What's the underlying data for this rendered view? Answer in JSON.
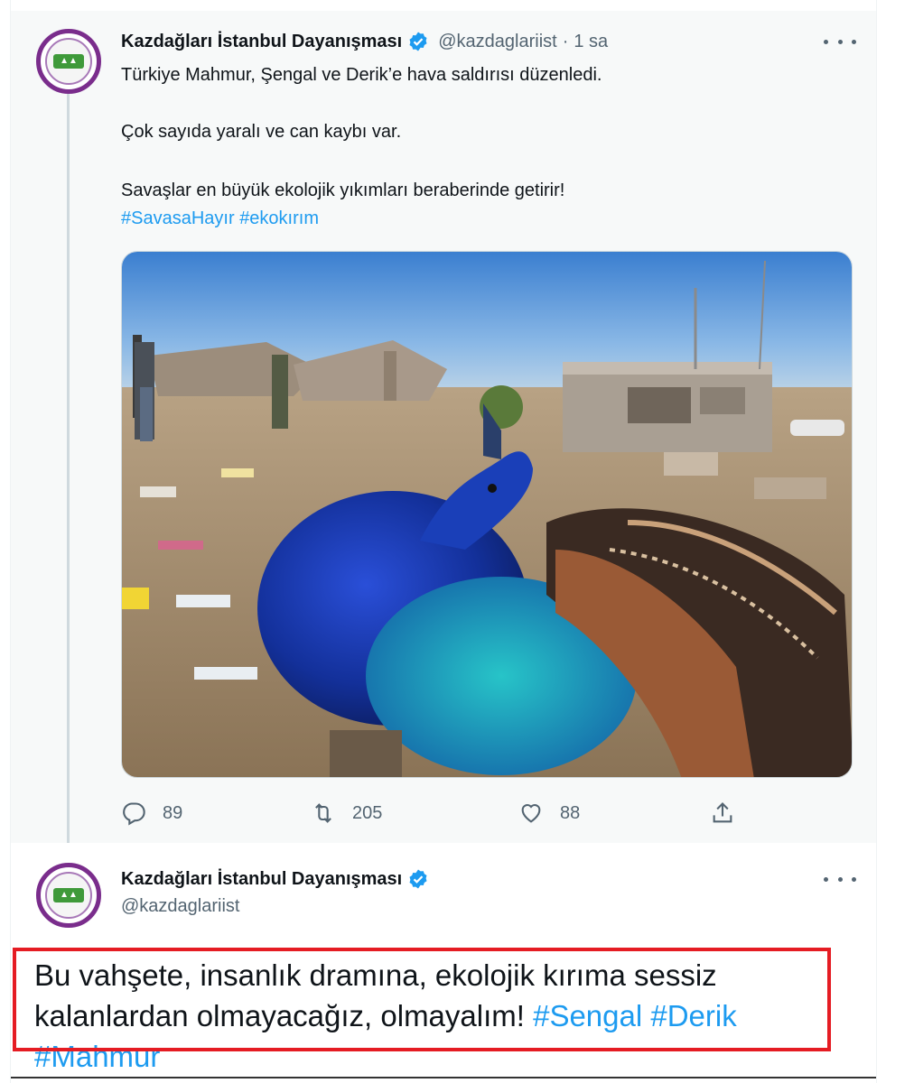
{
  "tweet": {
    "display_name": "Kazdağları İstanbul Dayanışması",
    "handle": "@kazdaglariist",
    "separator": "·",
    "time": "1 sa",
    "lines": [
      "Türkiye Mahmur, Şengal ve Derik’e hava saldırısı düzenledi.",
      "Çok sayıda yaralı ve can kaybı var.",
      "Savaşlar en büyük ekolojik yıkımları beraberinde getirir!"
    ],
    "hashtags": [
      "#SavasaHayır",
      "#ekokırım"
    ],
    "stats": {
      "replies": "89",
      "retweets": "205",
      "likes": "88"
    }
  },
  "reply": {
    "display_name": "Kazdağları İstanbul Dayanışması",
    "handle": "@kazdaglariist",
    "text_line1": "Bu vahşete, insanlık dramına, ekolojik kırıma sessiz",
    "text_line2": "kalanlardan olmayacağız, olmayalım!",
    "hashtags": [
      "#Sengal",
      "#Derik",
      "#Mahmur"
    ]
  },
  "colors": {
    "accent": "#1d9bf0",
    "highlight_box": "#e51c23",
    "avatar_ring": "#7a2d8c"
  }
}
